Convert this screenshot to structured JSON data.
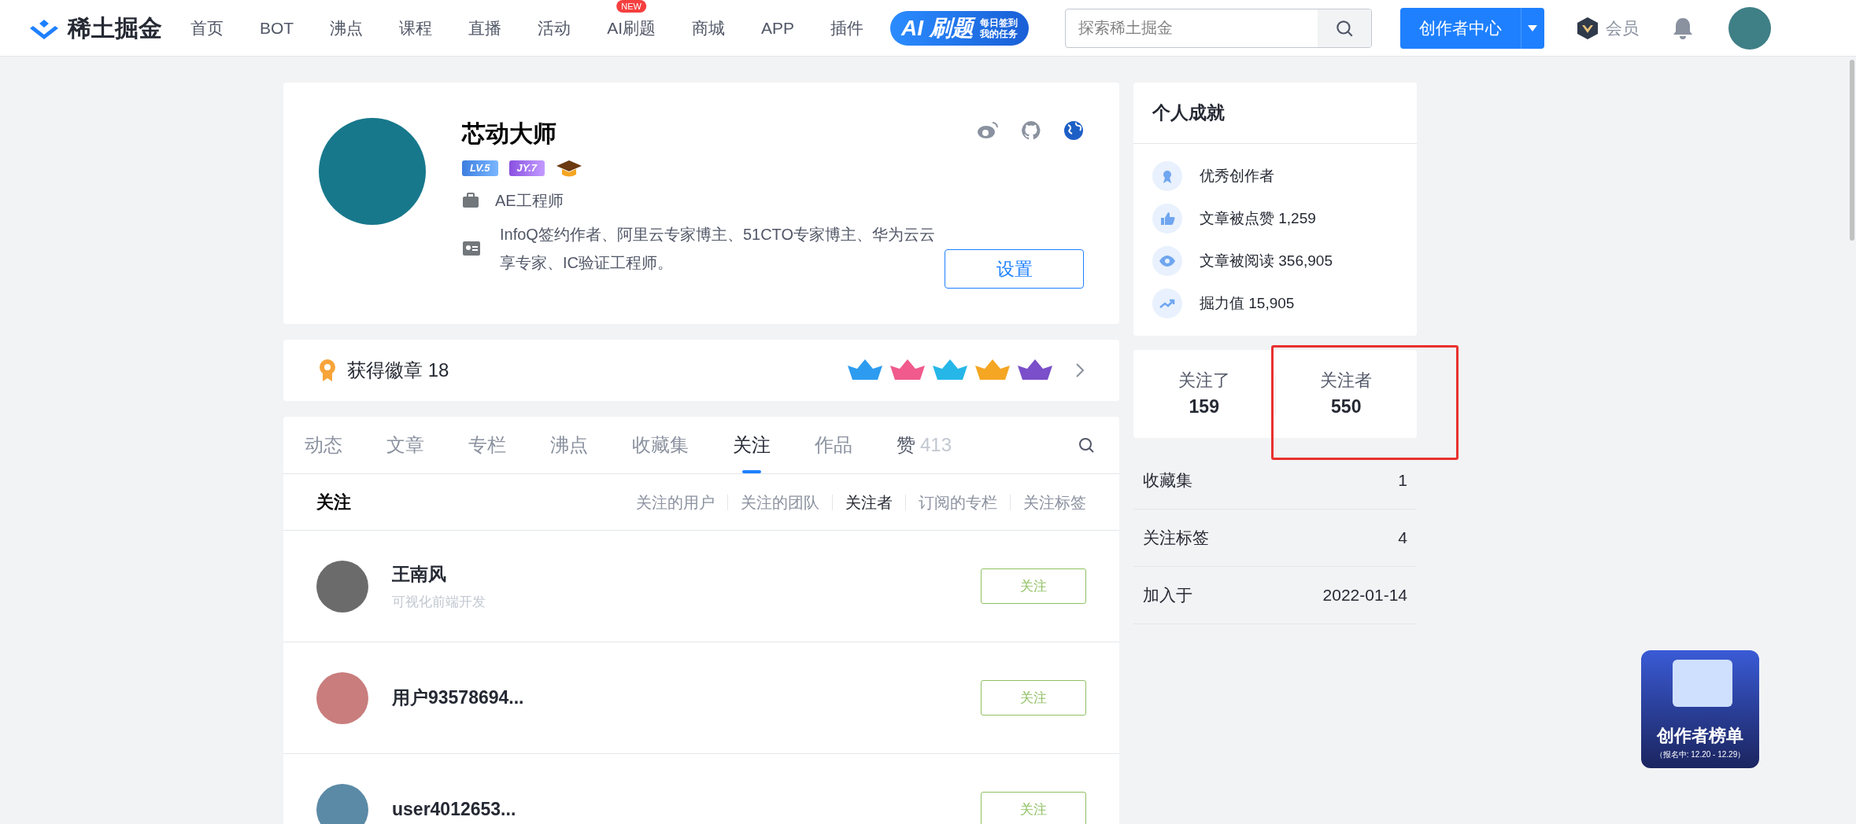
{
  "header": {
    "logo_text": "稀土掘金",
    "nav": [
      {
        "label": "首页"
      },
      {
        "label": "BOT"
      },
      {
        "label": "沸点"
      },
      {
        "label": "课程"
      },
      {
        "label": "直播"
      },
      {
        "label": "活动"
      },
      {
        "label": "AI刷题",
        "badge": "NEW"
      },
      {
        "label": "商城"
      },
      {
        "label": "APP"
      },
      {
        "label": "插件"
      }
    ],
    "ai_banner": {
      "title": "AI 刷题",
      "lines": [
        "每日签到",
        "我的任务"
      ]
    },
    "search": {
      "placeholder": "探索稀土掘金"
    },
    "creator_button": "创作者中心",
    "member": "会员"
  },
  "profile": {
    "name": "芯动大师",
    "levels": [
      "LV.5",
      "JY.7"
    ],
    "job": "AE工程师",
    "bio": "InfoQ签约作者、阿里云专家博主、51CTO专家博主、华为云云享专家、IC验证工程师。",
    "settings_button": "设置"
  },
  "badges": {
    "label": "获得徽章 18"
  },
  "tabs": [
    {
      "label": "动态",
      "selected": false
    },
    {
      "label": "文章",
      "selected": false
    },
    {
      "label": "专栏",
      "selected": false
    },
    {
      "label": "沸点",
      "selected": false
    },
    {
      "label": "收藏集",
      "selected": false
    },
    {
      "label": "关注",
      "selected": true
    },
    {
      "label": "作品",
      "selected": false
    },
    {
      "label": "赞",
      "count": "413",
      "selected": false
    }
  ],
  "follow_section": {
    "title": "关注",
    "filters": [
      {
        "label": "关注的用户",
        "selected": false
      },
      {
        "label": "关注的团队",
        "selected": false
      },
      {
        "label": "关注者",
        "selected": true
      },
      {
        "label": "订阅的专栏",
        "selected": false
      },
      {
        "label": "关注标签",
        "selected": false
      }
    ]
  },
  "users": [
    {
      "name": "王南风",
      "subtitle": "可视化前端开发",
      "button": "关注",
      "color": "#6b6b6b"
    },
    {
      "name": "用户93578694...",
      "button": "关注",
      "color": "#c97d7d"
    },
    {
      "name": "user4012653...",
      "button": "关注",
      "color": "#5b8aa6"
    }
  ],
  "achievements": {
    "title": "个人成就",
    "items": [
      {
        "kind": "award",
        "text": "优秀创作者"
      },
      {
        "kind": "like",
        "text": "文章被点赞 1,259"
      },
      {
        "kind": "view",
        "text": "文章被阅读 356,905"
      },
      {
        "kind": "power",
        "text": "掘力值 15,905"
      }
    ]
  },
  "follow_stats": [
    {
      "label": "关注了",
      "value": "159",
      "annotated": false
    },
    {
      "label": "关注者",
      "value": "550",
      "annotated": true
    }
  ],
  "stats": [
    {
      "label": "收藏集",
      "value": "1"
    },
    {
      "label": "关注标签",
      "value": "4"
    },
    {
      "label": "加入于",
      "value": "2022-01-14"
    }
  ],
  "promo": {
    "title": "创作者榜单",
    "subtitle": "（报名中: 12.20 - 12.29）"
  }
}
